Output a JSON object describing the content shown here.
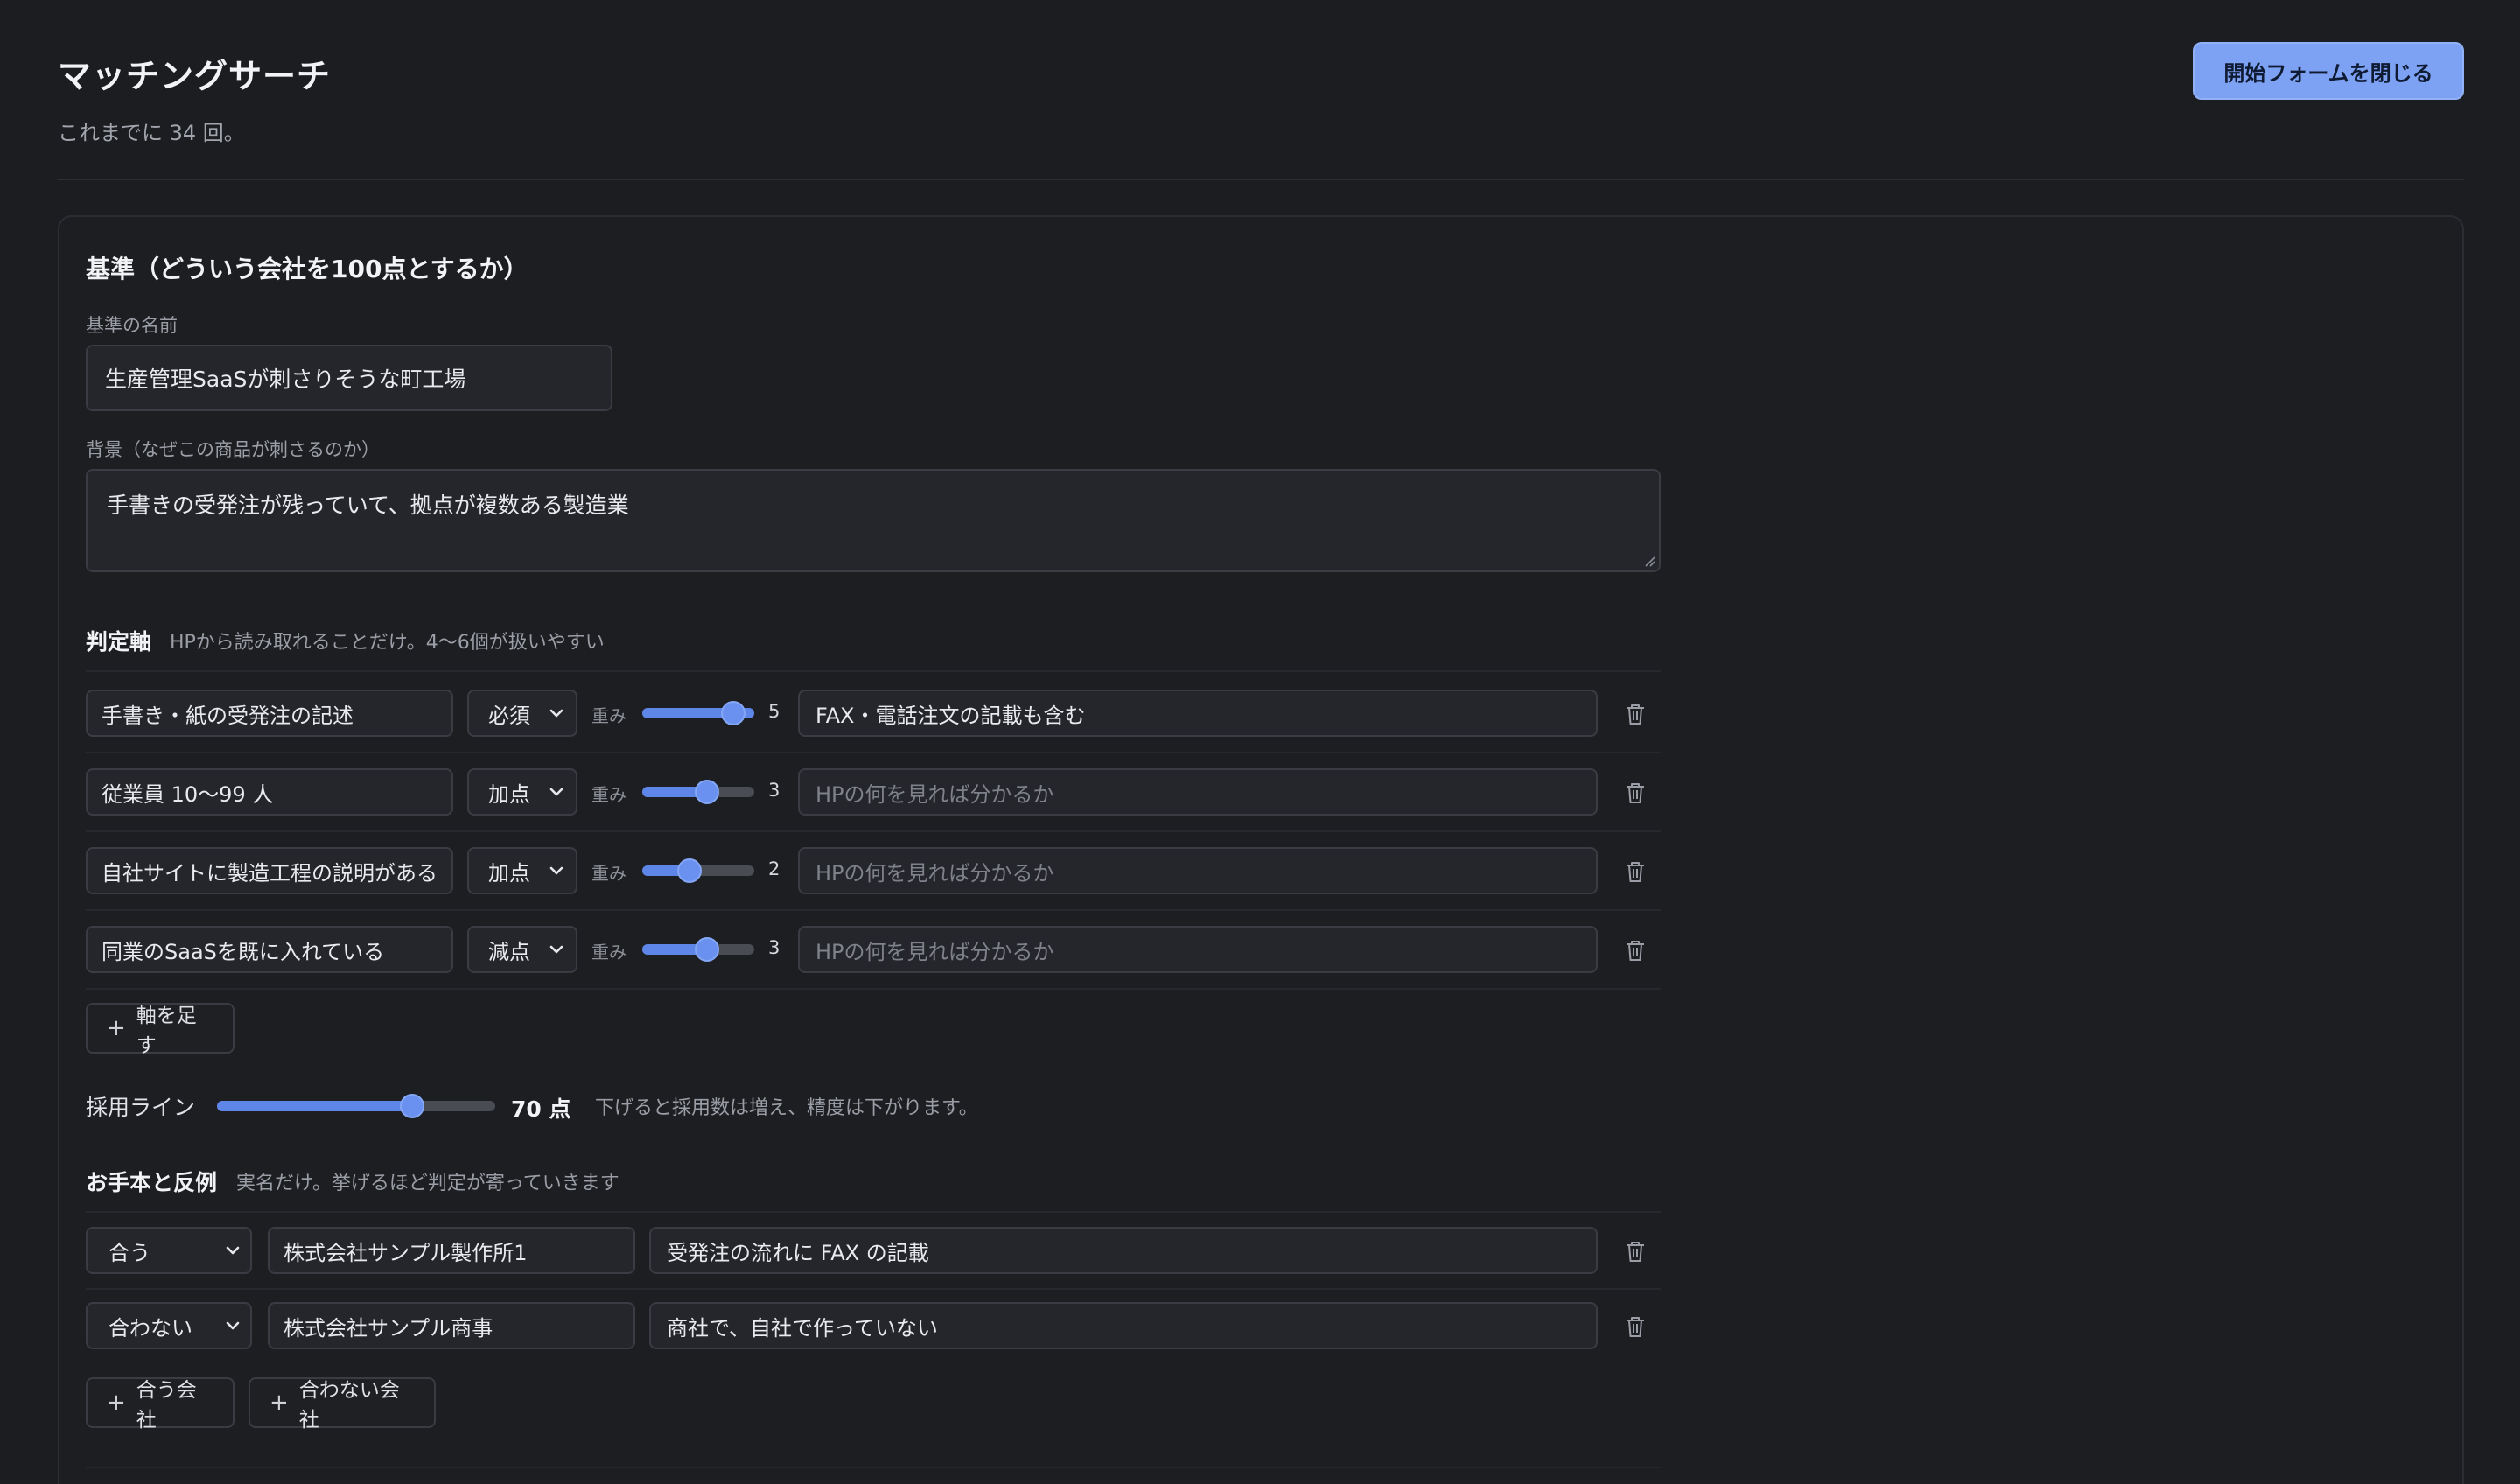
{
  "header": {
    "title": "マッチングサーチ",
    "subtitle": "これまでに 34 回。",
    "close_form_label": "開始フォームを閉じる"
  },
  "criteria": {
    "section_title": "基準（どういう会社を100点とするか）",
    "name_label": "基準の名前",
    "name_value": "生産管理SaaSが刺さりそうな町工場",
    "background_label": "背景（なぜこの商品が刺さるのか）",
    "background_value": "手書きの受発注が残っていて、拠点が複数ある製造業"
  },
  "axes": {
    "title": "判定軸",
    "hint": "HPから読み取れることだけ。4〜6個が扱いやすい",
    "weight_label": "重み",
    "weight_max": 5,
    "items": [
      {
        "name": "手書き・紙の受発注の記述",
        "type": "必須",
        "weight": 5,
        "note": "FAX・電話注文の記載も含む",
        "note_placeholder": "HPの何を見れば分かるか"
      },
      {
        "name": "従業員 10〜99 人",
        "type": "加点",
        "weight": 3,
        "note": "",
        "note_placeholder": "HPの何を見れば分かるか"
      },
      {
        "name": "自社サイトに製造工程の説明がある",
        "type": "加点",
        "weight": 2,
        "note": "",
        "note_placeholder": "HPの何を見れば分かるか"
      },
      {
        "name": "同業のSaaSを既に入れている",
        "type": "減点",
        "weight": 3,
        "note": "",
        "note_placeholder": "HPの何を見れば分かるか"
      }
    ],
    "add_label": "軸を足す"
  },
  "threshold": {
    "label": "採用ライン",
    "value": 70,
    "value_text": "70 点",
    "max": 100,
    "hint": "下げると採用数は増え、精度は下がります。"
  },
  "examples": {
    "title": "お手本と反例",
    "hint": "実名だけ。挙げるほど判定が寄っていきます",
    "items": [
      {
        "match": "合う",
        "company": "株式会社サンプル製作所1",
        "reason": "受発注の流れに FAX の記載"
      },
      {
        "match": "合わない",
        "company": "株式会社サンプル商事",
        "reason": "商社で、自社で作っていない"
      }
    ],
    "add_match_label": "合う会社",
    "add_nonmatch_label": "合わない会社"
  },
  "colors": {
    "accent": "#7da2f3",
    "slider": "#5e86e8",
    "background": "#1c1d21"
  }
}
